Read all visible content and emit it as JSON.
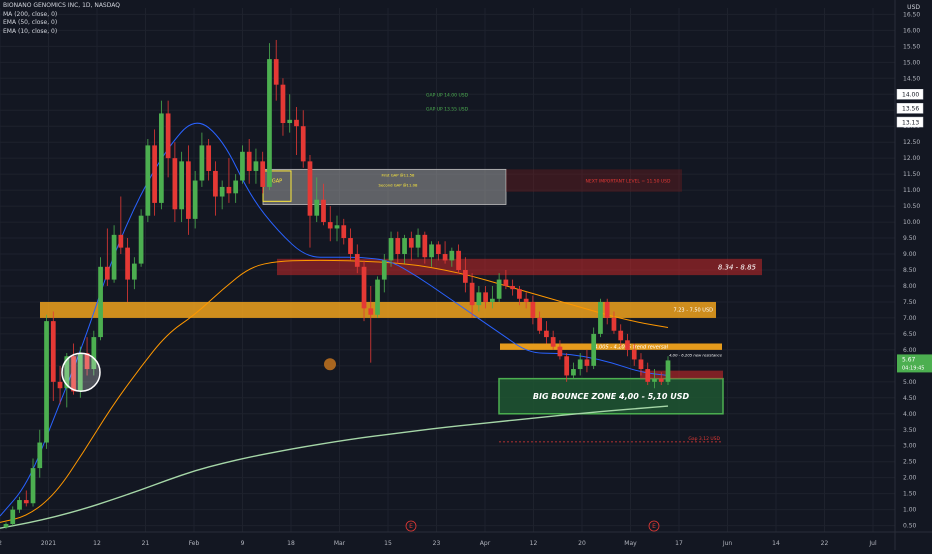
{
  "legend": {
    "title": "BIONANO GENOMICS INC, 1D, NASDAQ",
    "ma200": "MA (200, close, 0)",
    "ema50": "EMA (50, close, 0)",
    "ema10": "EMA (10, close, 0)"
  },
  "currency_label": "USD",
  "colors": {
    "background": "#131722",
    "grid": "#1e222d",
    "up": "#4caf50",
    "down": "#e53935",
    "ma200": "#a5d6a7",
    "ema50": "#ff9800",
    "ema10": "#2962ff",
    "orange_zone": "#f0a21c",
    "red_zone": "#c62828",
    "green_zone": "#1e5631"
  },
  "chart_data": {
    "type": "line",
    "subtype": "candlestick",
    "y_ticks": [
      "16.50",
      "16.00",
      "15.50",
      "15.00",
      "14.50",
      "14.00",
      "13.50",
      "13.00",
      "12.50",
      "12.00",
      "11.50",
      "11.00",
      "10.50",
      "10.00",
      "9.50",
      "9.00",
      "8.50",
      "8.00",
      "7.50",
      "7.00",
      "6.50",
      "6.00",
      "5.50",
      "5.00",
      "4.50",
      "4.00",
      "3.50",
      "3.00",
      "2.50",
      "2.00",
      "1.50",
      "1.00",
      "0.50"
    ],
    "ylim": [
      0.3,
      16.7
    ],
    "x_ticks": [
      "2",
      "2021",
      "12",
      "21",
      "Feb",
      "9",
      "18",
      "Mar",
      "15",
      "23",
      "Apr",
      "12",
      "20",
      "May",
      "17",
      "Jun",
      "14",
      "22",
      "Jul"
    ],
    "price_labels": [
      {
        "text": "14.00",
        "value": 14.0,
        "style": "white"
      },
      {
        "text": "13.56",
        "value": 13.56,
        "style": "white"
      },
      {
        "text": "13.13",
        "value": 13.13,
        "style": "white"
      },
      {
        "text": "5.67",
        "sub": "04:19:45",
        "value": 5.67,
        "style": "green"
      }
    ],
    "series": [
      {
        "name": "MA (200, close, 0)",
        "x": [
          0,
          1,
          2,
          3,
          4,
          5,
          6,
          7,
          8,
          9,
          10,
          11,
          12,
          13,
          14,
          15,
          16,
          17,
          18,
          19,
          20,
          21,
          22,
          23,
          24
        ],
        "values": [
          0.42,
          0.58,
          0.78,
          1.02,
          1.3,
          1.6,
          1.92,
          2.22,
          2.45,
          2.65,
          2.82,
          2.98,
          3.12,
          3.25,
          3.36,
          3.47,
          3.58,
          3.67,
          3.76,
          3.85,
          3.94,
          4.02,
          4.1,
          4.17,
          4.24
        ]
      },
      {
        "name": "EMA (50, close, 0)",
        "x": [
          0,
          1,
          2,
          3,
          4,
          5,
          6,
          7,
          8,
          9,
          10,
          11,
          12,
          13,
          14,
          15,
          16,
          17,
          18,
          19,
          20,
          21,
          22,
          23,
          24
        ],
        "values": [
          0.6,
          0.8,
          1.5,
          2.8,
          4.2,
          5.4,
          6.5,
          7.1,
          7.9,
          8.6,
          8.78,
          8.8,
          8.8,
          8.78,
          8.73,
          8.65,
          8.5,
          8.3,
          8.05,
          7.8,
          7.55,
          7.3,
          7.05,
          6.85,
          6.7
        ]
      },
      {
        "name": "EMA (10, close, 0)",
        "x": [
          0,
          1,
          2,
          3,
          4,
          5,
          6,
          7,
          8,
          9,
          10,
          11,
          12,
          13,
          14,
          15,
          16,
          17,
          18,
          19,
          20,
          21,
          22,
          23,
          24
        ],
        "values": [
          0.8,
          1.8,
          4.0,
          6.2,
          8.8,
          10.8,
          12.3,
          13.3,
          12.6,
          10.8,
          9.7,
          8.9,
          8.9,
          8.9,
          8.8,
          8.3,
          7.7,
          7.1,
          6.5,
          5.9,
          5.9,
          5.8,
          5.6,
          5.3,
          5.2
        ]
      }
    ],
    "zones": [
      {
        "label": "8.34 - 8.85",
        "low": 8.34,
        "high": 8.85,
        "color": "red"
      },
      {
        "label": "7.23 - 7.50 USD",
        "low": 7.0,
        "high": 7.5,
        "color": "orange"
      },
      {
        "label": "4.005 - 4.2005 trend reversal",
        "low": 6.0,
        "high": 6.2,
        "color": "orange"
      },
      {
        "label": "BIG BOUNCE ZONE 4,00 - 5,10 USD",
        "low": 4.0,
        "high": 5.1,
        "color": "green"
      }
    ],
    "annotations": [
      {
        "text": "GAP UP 14.00 USD",
        "value": 14.0
      },
      {
        "text": "GAP UP 13.55 USD",
        "value": 13.55
      },
      {
        "text": "GAP",
        "value": 11.3
      },
      {
        "text": "First GAP @11.58",
        "value": 11.4
      },
      {
        "text": "Second GAP @11.08",
        "value": 11.15
      },
      {
        "text": "NEXT IMPORTANT LEVEL = 11.50 USD",
        "value": 11.3
      },
      {
        "text": "4,00 - 6.205 new resistance",
        "value": 5.85
      },
      {
        "text": "Gap 3,12 USD",
        "value": 3.12
      }
    ],
    "candles": [
      {
        "o": 0.45,
        "h": 0.6,
        "l": 0.4,
        "c": 0.55
      },
      {
        "o": 0.55,
        "h": 1.1,
        "l": 0.5,
        "c": 1.0
      },
      {
        "o": 1.0,
        "h": 1.4,
        "l": 0.9,
        "c": 1.3
      },
      {
        "o": 1.3,
        "h": 1.6,
        "l": 1.1,
        "c": 1.2
      },
      {
        "o": 1.2,
        "h": 2.6,
        "l": 1.1,
        "c": 2.3
      },
      {
        "o": 2.3,
        "h": 3.5,
        "l": 2.0,
        "c": 3.1
      },
      {
        "o": 3.1,
        "h": 7.1,
        "l": 2.9,
        "c": 6.9
      },
      {
        "o": 6.9,
        "h": 7.2,
        "l": 4.4,
        "c": 5.0
      },
      {
        "o": 5.0,
        "h": 5.5,
        "l": 4.3,
        "c": 4.8
      },
      {
        "o": 4.8,
        "h": 5.9,
        "l": 4.2,
        "c": 5.8
      },
      {
        "o": 5.8,
        "h": 6.2,
        "l": 4.6,
        "c": 4.7
      },
      {
        "o": 4.7,
        "h": 6.1,
        "l": 4.5,
        "c": 5.9
      },
      {
        "o": 5.9,
        "h": 6.4,
        "l": 5.2,
        "c": 5.4
      },
      {
        "o": 5.4,
        "h": 6.6,
        "l": 5.2,
        "c": 6.4
      },
      {
        "o": 6.4,
        "h": 8.9,
        "l": 6.3,
        "c": 8.6
      },
      {
        "o": 8.6,
        "h": 9.8,
        "l": 8.0,
        "c": 8.2
      },
      {
        "o": 8.2,
        "h": 9.9,
        "l": 8.1,
        "c": 9.6
      },
      {
        "o": 9.6,
        "h": 10.8,
        "l": 9.0,
        "c": 9.2
      },
      {
        "o": 9.2,
        "h": 9.5,
        "l": 7.5,
        "c": 8.2
      },
      {
        "o": 8.2,
        "h": 8.9,
        "l": 7.9,
        "c": 8.7
      },
      {
        "o": 8.7,
        "h": 10.4,
        "l": 8.6,
        "c": 10.2
      },
      {
        "o": 10.2,
        "h": 12.6,
        "l": 10.0,
        "c": 12.4
      },
      {
        "o": 12.4,
        "h": 12.9,
        "l": 10.2,
        "c": 10.6
      },
      {
        "o": 10.6,
        "h": 13.8,
        "l": 10.4,
        "c": 13.4
      },
      {
        "o": 13.4,
        "h": 13.8,
        "l": 11.4,
        "c": 12.0
      },
      {
        "o": 12.0,
        "h": 12.5,
        "l": 10.0,
        "c": 10.4
      },
      {
        "o": 10.4,
        "h": 12.2,
        "l": 10.0,
        "c": 11.9
      },
      {
        "o": 11.9,
        "h": 12.4,
        "l": 9.6,
        "c": 10.1
      },
      {
        "o": 10.1,
        "h": 11.6,
        "l": 9.8,
        "c": 11.3
      },
      {
        "o": 11.3,
        "h": 12.8,
        "l": 11.1,
        "c": 12.4
      },
      {
        "o": 12.4,
        "h": 12.6,
        "l": 11.3,
        "c": 11.6
      },
      {
        "o": 11.6,
        "h": 11.9,
        "l": 10.2,
        "c": 10.8
      },
      {
        "o": 10.8,
        "h": 11.3,
        "l": 10.4,
        "c": 11.1
      },
      {
        "o": 11.1,
        "h": 12.0,
        "l": 10.6,
        "c": 10.9
      },
      {
        "o": 10.9,
        "h": 11.5,
        "l": 10.6,
        "c": 11.3
      },
      {
        "o": 11.3,
        "h": 12.4,
        "l": 11.2,
        "c": 12.2
      },
      {
        "o": 12.2,
        "h": 12.6,
        "l": 11.2,
        "c": 11.6
      },
      {
        "o": 11.6,
        "h": 12.3,
        "l": 11.2,
        "c": 11.9
      },
      {
        "o": 11.9,
        "h": 12.2,
        "l": 10.9,
        "c": 11.1
      },
      {
        "o": 11.1,
        "h": 15.6,
        "l": 11.0,
        "c": 15.1
      },
      {
        "o": 15.1,
        "h": 15.7,
        "l": 13.8,
        "c": 14.3
      },
      {
        "o": 14.3,
        "h": 14.5,
        "l": 12.7,
        "c": 13.1
      },
      {
        "o": 13.1,
        "h": 14.0,
        "l": 12.8,
        "c": 13.2
      },
      {
        "o": 13.2,
        "h": 13.6,
        "l": 12.1,
        "c": 13.0
      },
      {
        "o": 13.0,
        "h": 13.5,
        "l": 11.7,
        "c": 11.9
      },
      {
        "o": 11.9,
        "h": 12.1,
        "l": 9.2,
        "c": 10.2
      },
      {
        "o": 10.2,
        "h": 11.4,
        "l": 10.0,
        "c": 10.7
      },
      {
        "o": 10.7,
        "h": 11.2,
        "l": 9.9,
        "c": 10.0
      },
      {
        "o": 10.0,
        "h": 10.5,
        "l": 9.4,
        "c": 9.8
      },
      {
        "o": 9.8,
        "h": 10.2,
        "l": 9.4,
        "c": 9.9
      },
      {
        "o": 9.9,
        "h": 10.1,
        "l": 9.3,
        "c": 9.5
      },
      {
        "o": 9.5,
        "h": 9.8,
        "l": 8.8,
        "c": 9.0
      },
      {
        "o": 9.0,
        "h": 9.3,
        "l": 8.4,
        "c": 8.6
      },
      {
        "o": 8.6,
        "h": 8.8,
        "l": 6.9,
        "c": 7.3
      },
      {
        "o": 7.3,
        "h": 8.0,
        "l": 5.6,
        "c": 7.1
      },
      {
        "o": 7.1,
        "h": 8.3,
        "l": 7.0,
        "c": 8.2
      },
      {
        "o": 8.2,
        "h": 9.0,
        "l": 7.8,
        "c": 8.8
      },
      {
        "o": 8.8,
        "h": 9.7,
        "l": 8.6,
        "c": 9.5
      },
      {
        "o": 9.5,
        "h": 9.7,
        "l": 8.7,
        "c": 9.0
      },
      {
        "o": 9.0,
        "h": 9.6,
        "l": 8.7,
        "c": 9.5
      },
      {
        "o": 9.5,
        "h": 9.7,
        "l": 8.8,
        "c": 9.2
      },
      {
        "o": 9.2,
        "h": 9.8,
        "l": 8.9,
        "c": 9.6
      },
      {
        "o": 9.6,
        "h": 9.7,
        "l": 8.7,
        "c": 8.9
      },
      {
        "o": 8.9,
        "h": 9.4,
        "l": 8.6,
        "c": 9.3
      },
      {
        "o": 9.3,
        "h": 9.4,
        "l": 8.8,
        "c": 9.0
      },
      {
        "o": 9.0,
        "h": 9.4,
        "l": 8.7,
        "c": 8.8
      },
      {
        "o": 8.8,
        "h": 9.2,
        "l": 8.6,
        "c": 9.1
      },
      {
        "o": 9.1,
        "h": 9.3,
        "l": 8.4,
        "c": 8.5
      },
      {
        "o": 8.5,
        "h": 8.9,
        "l": 7.8,
        "c": 8.1
      },
      {
        "o": 8.1,
        "h": 8.4,
        "l": 7.0,
        "c": 7.4
      },
      {
        "o": 7.4,
        "h": 8.0,
        "l": 7.2,
        "c": 7.8
      },
      {
        "o": 7.8,
        "h": 8.0,
        "l": 7.3,
        "c": 7.5
      },
      {
        "o": 7.5,
        "h": 8.0,
        "l": 7.3,
        "c": 7.6
      },
      {
        "o": 7.6,
        "h": 8.4,
        "l": 7.5,
        "c": 8.2
      },
      {
        "o": 8.2,
        "h": 8.5,
        "l": 7.9,
        "c": 8.0
      },
      {
        "o": 8.0,
        "h": 8.2,
        "l": 7.7,
        "c": 7.9
      },
      {
        "o": 7.9,
        "h": 8.0,
        "l": 7.4,
        "c": 7.6
      },
      {
        "o": 7.6,
        "h": 7.8,
        "l": 7.3,
        "c": 7.5
      },
      {
        "o": 7.5,
        "h": 7.7,
        "l": 6.8,
        "c": 7.0
      },
      {
        "o": 7.0,
        "h": 7.2,
        "l": 6.5,
        "c": 6.6
      },
      {
        "o": 6.6,
        "h": 6.9,
        "l": 6.2,
        "c": 6.4
      },
      {
        "o": 6.4,
        "h": 6.6,
        "l": 6.0,
        "c": 6.1
      },
      {
        "o": 6.1,
        "h": 6.3,
        "l": 5.7,
        "c": 5.8
      },
      {
        "o": 5.8,
        "h": 5.9,
        "l": 5.0,
        "c": 5.2
      },
      {
        "o": 5.2,
        "h": 5.6,
        "l": 5.1,
        "c": 5.4
      },
      {
        "o": 5.4,
        "h": 5.9,
        "l": 5.2,
        "c": 5.7
      },
      {
        "o": 5.7,
        "h": 6.0,
        "l": 5.3,
        "c": 5.5
      },
      {
        "o": 5.5,
        "h": 6.7,
        "l": 5.4,
        "c": 6.5
      },
      {
        "o": 6.5,
        "h": 7.6,
        "l": 6.4,
        "c": 7.5
      },
      {
        "o": 7.5,
        "h": 7.6,
        "l": 6.8,
        "c": 7.0
      },
      {
        "o": 7.0,
        "h": 7.2,
        "l": 6.5,
        "c": 6.6
      },
      {
        "o": 6.6,
        "h": 6.8,
        "l": 6.1,
        "c": 6.3
      },
      {
        "o": 6.3,
        "h": 6.5,
        "l": 5.8,
        "c": 6.0
      },
      {
        "o": 6.0,
        "h": 6.2,
        "l": 5.5,
        "c": 5.7
      },
      {
        "o": 5.7,
        "h": 5.9,
        "l": 5.2,
        "c": 5.4
      },
      {
        "o": 5.4,
        "h": 5.6,
        "l": 4.9,
        "c": 5.0
      },
      {
        "o": 5.0,
        "h": 5.4,
        "l": 4.8,
        "c": 5.1
      },
      {
        "o": 5.1,
        "h": 5.3,
        "l": 4.9,
        "c": 5.0
      },
      {
        "o": 5.0,
        "h": 5.8,
        "l": 4.9,
        "c": 5.67
      }
    ]
  }
}
